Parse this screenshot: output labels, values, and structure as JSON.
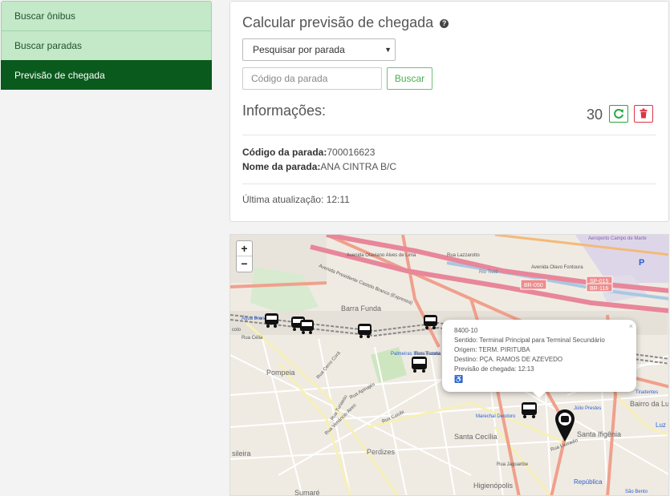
{
  "sidebar": {
    "items": [
      {
        "label": "Buscar ônibus"
      },
      {
        "label": "Buscar paradas"
      },
      {
        "label": "Previsão de chegada"
      }
    ]
  },
  "panel": {
    "title": "Calcular previsão de chegada",
    "help_icon": "question-circle-icon",
    "search_mode": "Pesquisar por parada",
    "stop_code_placeholder": "Código da parada",
    "search_button": "Buscar",
    "info_title": "Informações:",
    "countdown": "30",
    "stop_code_label": "Código da parada:",
    "stop_code_value": "700016623",
    "stop_name_label": "Nome da parada:",
    "stop_name_value": "ANA CINTRA B/C",
    "last_update": "Última atualização: 12:11"
  },
  "map": {
    "zoom_in": "+",
    "zoom_out": "−",
    "popup": {
      "line": "8400-10",
      "sentido": "Sentido: Terminal Principal para Terminal Secundário",
      "origem": "Origem: TERM. PIRITUBA",
      "destino": "Destino: PÇA. RAMOS DE AZEVEDO",
      "previsao": "Previsão de chegada: 12:13",
      "accessible_icon": "wheelchair-icon",
      "close": "×"
    },
    "labels": {
      "av_otaviano": "Avenida Otaviano Alves de Lima",
      "av_castelo": "Avenida Presidente Castelo Branco (Expressa)",
      "rua_lazzarotto": "Rua Lazzarotto",
      "av_olavo": "Avenida Olavo Fontoura",
      "aeroporto": "Aeroporto Campo de Marte",
      "br050": "BR-050",
      "sp015": "SP-015",
      "br116": "BR-116",
      "barra_funda": "Barra Funda",
      "agua_branca": "Água Branca",
      "palmeiras": "Palmeiras Barra Funda",
      "pompeia": "Pompeia",
      "perdizes": "Perdizes",
      "santa_cecilia": "Santa Cecília",
      "marechal": "Marechal Deodoro",
      "julio_prestes": "Júlio Prestes",
      "tiradentes": "Tiradentes",
      "santa_ifigenia": "Santa Ifigênia",
      "bairro_luz": "Bairro da Luz",
      "higienopolis": "Higienópolis",
      "sumare": "Sumaré",
      "republica": "República",
      "sao_bento": "São Bento",
      "rua_cerro": "Rua Cerro Corá",
      "rua_tucuna": "Rua Tucuna",
      "rua_apinaje": "Rua Apinajés",
      "rua_caiubi": "Rua Caiubi",
      "rua_turiassu": "Rua Turiassu",
      "rua_venancio": "Rua Venâncio Aires",
      "rua_jaguaribe": "Rua Jaguaribe",
      "rua_lavradio": "Rua Lavradio",
      "rio_tiete": "Rio Tietê",
      "rua_celia": "Rua Célia",
      "luz": "Luz",
      "sileira": "sileira",
      "colo": "colo",
      "parking": "P"
    }
  }
}
